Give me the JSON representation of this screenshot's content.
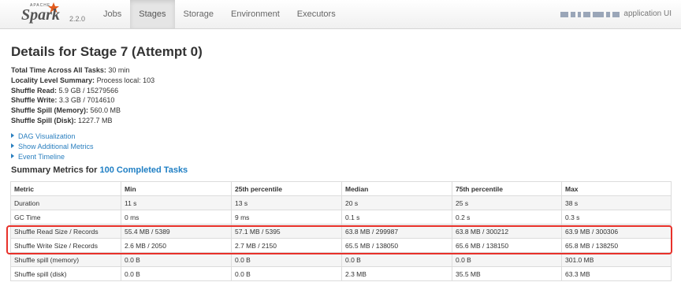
{
  "nav": {
    "brand_small": "APACHE",
    "brand": "Spark",
    "version": "2.2.0",
    "tabs": [
      {
        "label": "Jobs",
        "active": false
      },
      {
        "label": "Stages",
        "active": true
      },
      {
        "label": "Storage",
        "active": false
      },
      {
        "label": "Environment",
        "active": false
      },
      {
        "label": "Executors",
        "active": false
      }
    ],
    "app_title": "application UI"
  },
  "page": {
    "title": "Details for Stage 7 (Attempt 0)",
    "summary": [
      {
        "label": "Total Time Across All Tasks:",
        "value": "30 min"
      },
      {
        "label": "Locality Level Summary:",
        "value": "Process local: 103"
      },
      {
        "label": "Shuffle Read:",
        "value": "5.9 GB / 15279566"
      },
      {
        "label": "Shuffle Write:",
        "value": "3.3 GB / 7014610"
      },
      {
        "label": "Shuffle Spill (Memory):",
        "value": "560.0 MB"
      },
      {
        "label": "Shuffle Spill (Disk):",
        "value": "1227.7 MB"
      }
    ],
    "links": [
      "DAG Visualization",
      "Show Additional Metrics",
      "Event Timeline"
    ],
    "section_title_prefix": "Summary Metrics for",
    "section_title_link": "100 Completed Tasks"
  },
  "metrics_table": {
    "headers": [
      "Metric",
      "Min",
      "25th percentile",
      "Median",
      "75th percentile",
      "Max"
    ],
    "rows": [
      [
        "Duration",
        "11 s",
        "13 s",
        "20 s",
        "25 s",
        "38 s"
      ],
      [
        "GC Time",
        "0 ms",
        "9 ms",
        "0.1 s",
        "0.2 s",
        "0.3 s"
      ],
      [
        "Shuffle Read Size / Records",
        "55.4 MB / 5389",
        "57.1 MB / 5395",
        "63.8 MB / 299987",
        "63.8 MB / 300212",
        "63.9 MB / 300306"
      ],
      [
        "Shuffle Write Size / Records",
        "2.6 MB / 2050",
        "2.7 MB / 2150",
        "65.5 MB / 138050",
        "65.6 MB / 138150",
        "65.8 MB / 138250"
      ],
      [
        "Shuffle spill (memory)",
        "0.0 B",
        "0.0 B",
        "0.0 B",
        "0.0 B",
        "301.0 MB"
      ],
      [
        "Shuffle spill (disk)",
        "0.0 B",
        "0.0 B",
        "2.3 MB",
        "35.5 MB",
        "63.3 MB"
      ]
    ]
  },
  "colors": {
    "link": "#2a7fbf",
    "highlight": "#e8312a",
    "brand_star": "#e25a1c"
  }
}
